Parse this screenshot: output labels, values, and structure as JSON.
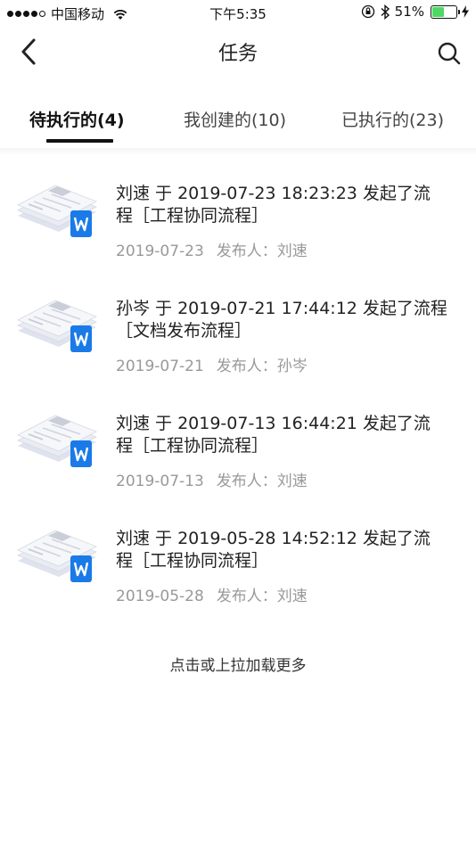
{
  "status_bar": {
    "carrier": "中国移动",
    "time": "下午5:35",
    "battery_percent": "51%",
    "battery_level": 0.51,
    "battery_color": "#4cd964"
  },
  "nav": {
    "title": "任务",
    "back_icon": "chevron-left-icon",
    "search_icon": "search-icon"
  },
  "tabs": [
    {
      "label": "待执行的(4)",
      "active": true
    },
    {
      "label": "我创建的(10)",
      "active": false
    },
    {
      "label": "已执行的(23)",
      "active": false
    }
  ],
  "tasks": [
    {
      "title_line1": "刘速 于  2019-07-23 18:23:23 发起了流",
      "title_line2": "程［工程协同流程］",
      "date": "2019-07-23",
      "publisher": "发布人：刘速"
    },
    {
      "title_line1": "孙岑 于  2019-07-21 17:44:12 发起了流程",
      "title_line2": "［文档发布流程］",
      "date": "2019-07-21",
      "publisher": "发布人：孙岑"
    },
    {
      "title_line1": "刘速 于  2019-07-13 16:44:21 发起了流",
      "title_line2": "程［工程协同流程］",
      "date": "2019-07-13",
      "publisher": "发布人：刘速"
    },
    {
      "title_line1": "刘速 于  2019-05-28 14:52:12 发起了流",
      "title_line2": "程［工程协同流程］",
      "date": "2019-05-28",
      "publisher": "发布人：刘速"
    }
  ],
  "load_more": "点击或上拉加载更多",
  "colors": {
    "accent": "#1a7ae8",
    "meta_text": "#999999"
  }
}
